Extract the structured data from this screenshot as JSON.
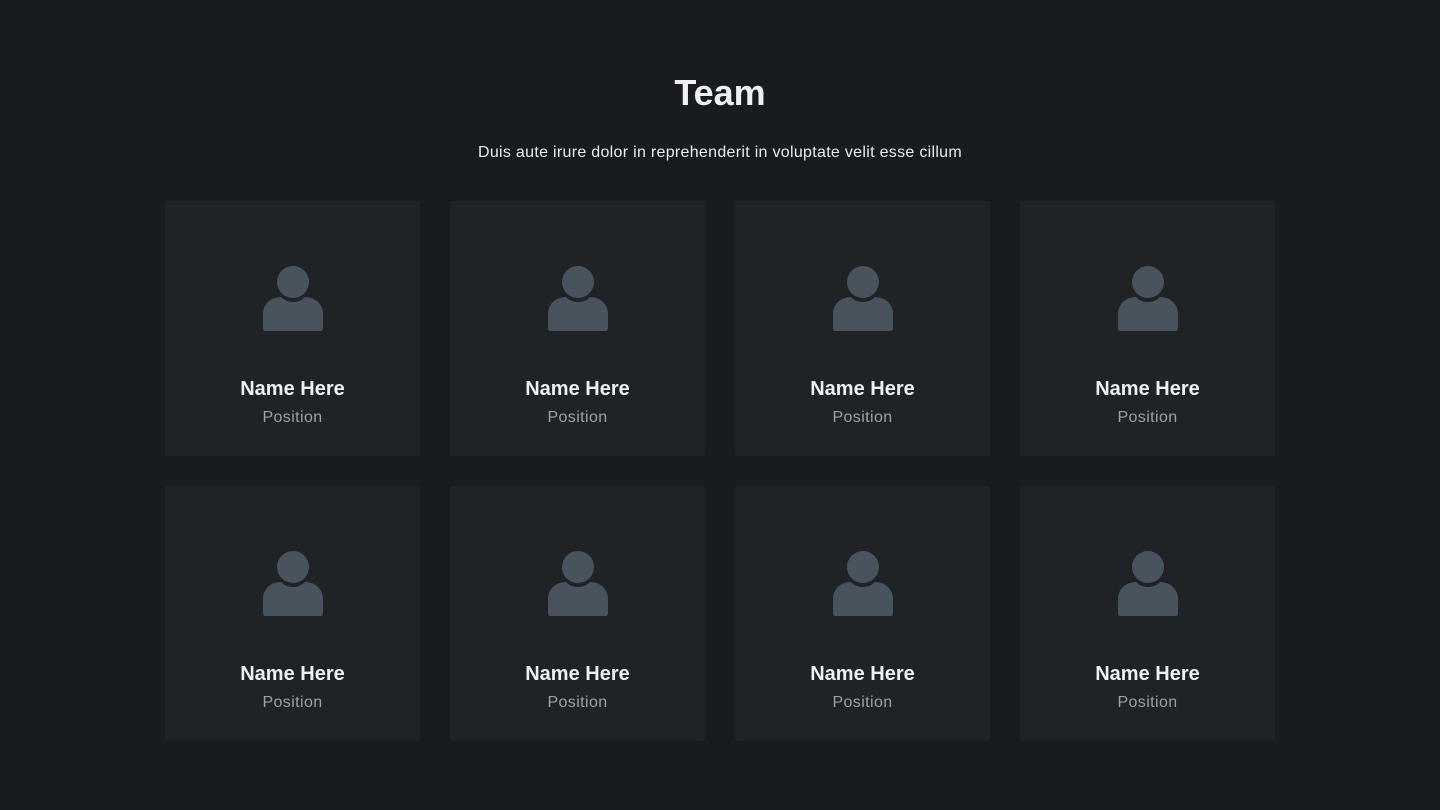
{
  "header": {
    "title": "Team",
    "subtitle": "Duis aute irure dolor in reprehenderit in voluptate velit esse cillum"
  },
  "team": [
    {
      "name": "Name Here",
      "position": "Position",
      "icon": "user-icon"
    },
    {
      "name": "Name Here",
      "position": "Position",
      "icon": "user-icon"
    },
    {
      "name": "Name Here",
      "position": "Position",
      "icon": "user-icon"
    },
    {
      "name": "Name Here",
      "position": "Position",
      "icon": "user-icon"
    },
    {
      "name": "Name Here",
      "position": "Position",
      "icon": "user-icon"
    },
    {
      "name": "Name Here",
      "position": "Position",
      "icon": "user-icon"
    },
    {
      "name": "Name Here",
      "position": "Position",
      "icon": "user-icon"
    },
    {
      "name": "Name Here",
      "position": "Position",
      "icon": "user-icon"
    }
  ],
  "colors": {
    "background": "#191c1f",
    "card": "#1f2326",
    "avatar": "#48535e",
    "text": "#eef0f2",
    "muted": "#9aa1a8"
  }
}
